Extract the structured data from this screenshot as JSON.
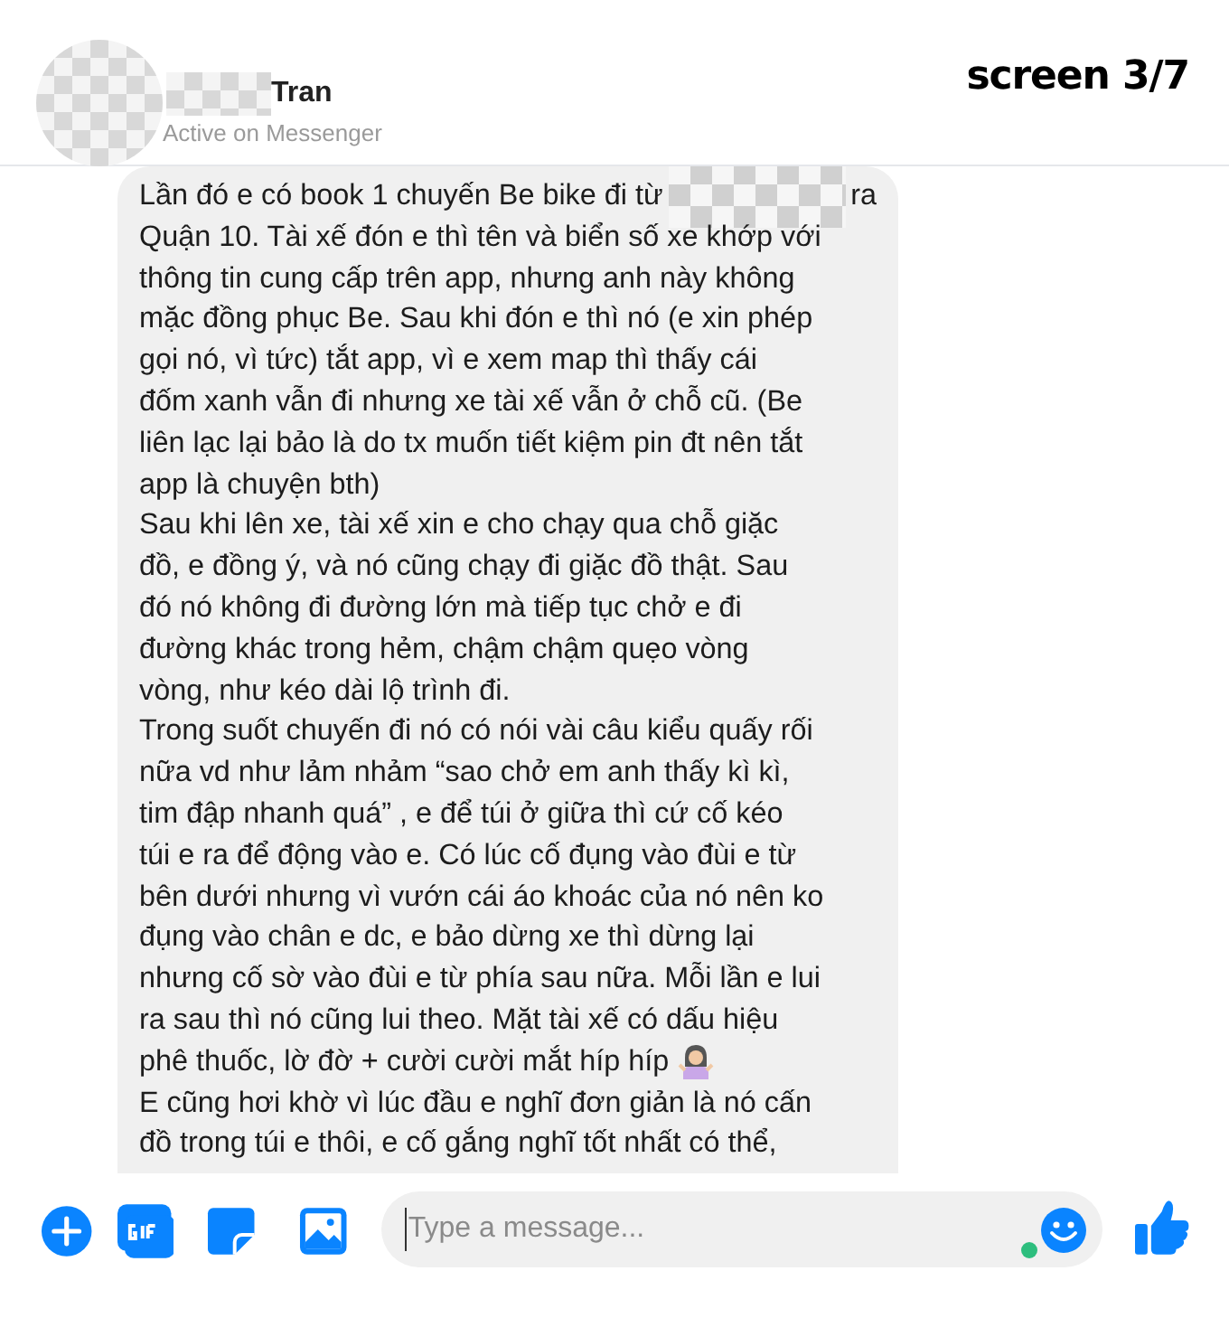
{
  "header": {
    "name": "Tran",
    "status": "Active on Messenger"
  },
  "page_label": "screen 3/7",
  "message": {
    "lines": [
      {
        "kind": "redacted",
        "before": "Lần đó e có book 1 chuyến Be bike đi từ",
        "after": "ra"
      },
      {
        "kind": "text",
        "text": "Quận 10. Tài xế đón e thì tên và biển số xe khớp với"
      },
      {
        "kind": "text",
        "text": "thông tin cung cấp trên app, nhưng anh này không"
      },
      {
        "kind": "text",
        "text": "mặc đồng phục Be. Sau khi đón e thì nó (e xin phép"
      },
      {
        "kind": "text",
        "text": "gọi nó, vì tức) tắt app, vì e xem map thì thấy cái"
      },
      {
        "kind": "text",
        "text": "đốm xanh vẫn đi nhưng xe tài xế vẫn ở chỗ cũ. (Be"
      },
      {
        "kind": "text",
        "text": "liên lạc lại bảo là do tx muốn tiết kiệm pin đt nên tắt"
      },
      {
        "kind": "text",
        "text": "app là chuyện bth)"
      },
      {
        "kind": "text",
        "text": "Sau khi lên xe, tài xế xin e cho chạy qua chỗ giặc"
      },
      {
        "kind": "text",
        "text": "đồ, e đồng ý, và nó cũng chạy đi giặc đồ thật. Sau"
      },
      {
        "kind": "text",
        "text": "đó nó không đi đường lớn mà tiếp tục chở e đi"
      },
      {
        "kind": "text",
        "text": "đường khác trong hẻm, chậm chậm quẹo vòng"
      },
      {
        "kind": "text",
        "text": "vòng, như kéo dài lộ trình đi."
      },
      {
        "kind": "text",
        "text": "Trong suốt chuyến đi nó có nói vài câu kiểu quấy rối"
      },
      {
        "kind": "text",
        "text": "nữa vd như lảm nhảm “sao chở em anh thấy kì kì,"
      },
      {
        "kind": "text",
        "text": "tim đập nhanh quá” , e để túi ở giữa thì cứ cố kéo"
      },
      {
        "kind": "text",
        "text": "túi e ra để động vào e. Có lúc cố đụng vào đùi e từ"
      },
      {
        "kind": "text",
        "text": "bên dưới nhưng vì vướn cái áo khoác của nó nên ko"
      },
      {
        "kind": "text",
        "text": "đụng vào chân e dc, e bảo dừng xe thì dừng lại"
      },
      {
        "kind": "text",
        "text": "nhưng cố sờ vào đùi e từ phía sau nữa. Mỗi lần e lui"
      },
      {
        "kind": "text",
        "text": "ra sau thì nó cũng lui theo. Mặt tài xế có dấu hiệu"
      },
      {
        "kind": "emoji",
        "text": "phê thuốc, lờ đờ + cười cười mắt híp híp"
      },
      {
        "kind": "text",
        "text": "E cũng hơi khờ vì lúc đầu e nghĩ đơn giản là nó cấn"
      },
      {
        "kind": "text",
        "text": "đồ trong túi e thôi, e cố gắng nghĩ tốt nhất có thể,"
      }
    ]
  },
  "composer": {
    "placeholder": "Type a message..."
  }
}
